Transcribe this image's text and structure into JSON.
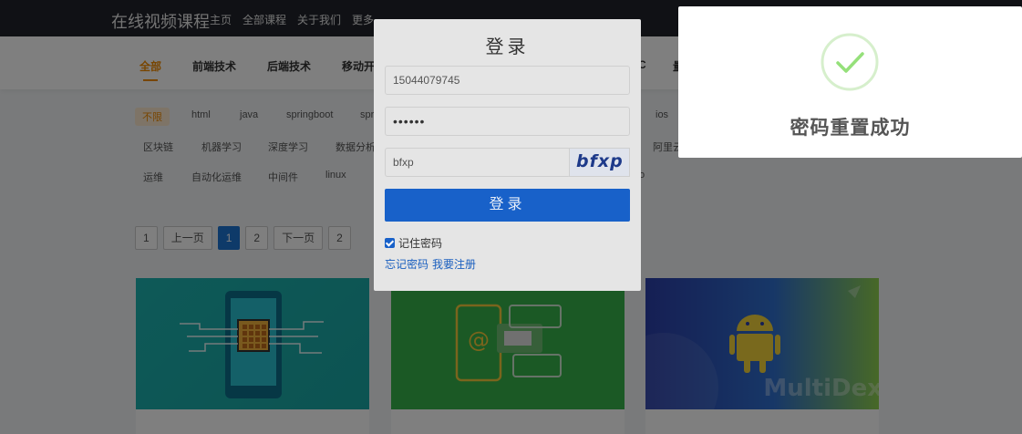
{
  "site": {
    "brand": "在线视频课程",
    "nav": [
      "主页",
      "全部课程",
      "关于我们",
      "更多"
    ]
  },
  "categories": {
    "items": [
      "全部",
      "前端技术",
      "后端技术",
      "移动开发"
    ],
    "partial_right_1": "C",
    "partial_right_2": "量"
  },
  "tags": {
    "row1": [
      "不限",
      "html",
      "java",
      "springboot",
      "spr",
      "ios"
    ],
    "row2": [
      "区块链",
      "机器学习",
      "深度学习",
      "数据分析",
      "阿里云"
    ],
    "row3": [
      "运维",
      "自动化运维",
      "中间件",
      "linux",
      "o"
    ]
  },
  "pagination": {
    "items": [
      "1",
      "上一页",
      "1",
      "2",
      "下一页",
      "2"
    ]
  },
  "cards": [
    {
      "thumb_label": ""
    },
    {
      "thumb_label": ""
    },
    {
      "thumb_label": "MultiDex"
    }
  ],
  "login": {
    "title": "登录",
    "username": "15044079745",
    "password_mask": "••••••",
    "captcha_input": "bfxp",
    "captcha_image_text": "bfxp",
    "submit_label": "登录",
    "remember_label": "记住密码",
    "forgot_label": "忘记密码",
    "register_label": "我要注册"
  },
  "toast": {
    "message": "密码重置成功",
    "icon": "check-circle-icon",
    "icon_color": "#95e07a"
  },
  "colors": {
    "accent_orange": "#f08a00",
    "primary_blue": "#1861c9",
    "topbar": "#20232a"
  }
}
